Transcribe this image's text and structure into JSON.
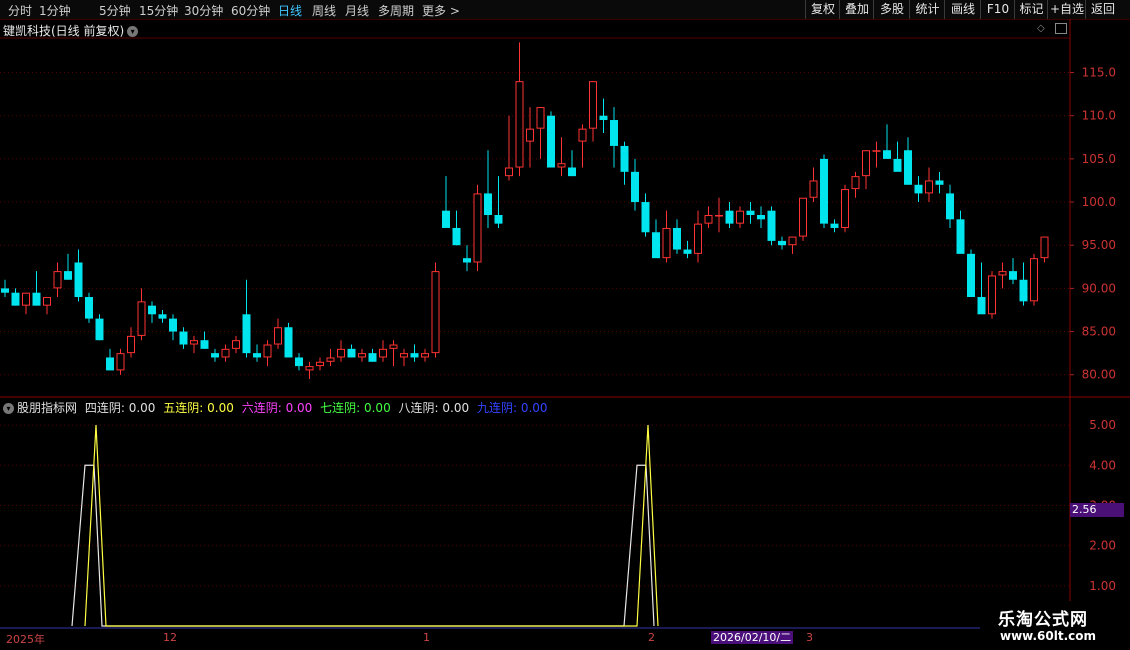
{
  "toolbar": {
    "tabs": [
      "分时",
      "1分钟",
      "5分钟",
      "15分钟",
      "30分钟",
      "60分钟",
      "日线",
      "周线",
      "月线",
      "多周期",
      "更多 >"
    ],
    "active_tab": "日线",
    "right_buttons": [
      "复权",
      "叠加",
      "多股",
      "统计",
      "画线",
      "F10",
      "标记",
      "+自选",
      "返回"
    ]
  },
  "main_title": "键凯科技(日线 前复权)",
  "indicator": {
    "name": "股朋指标网",
    "items": [
      {
        "label": "四连阴:",
        "value": "0.00",
        "color": "#e0e0e0"
      },
      {
        "label": "五连阴:",
        "value": "0.00",
        "color": "#ffff44"
      },
      {
        "label": "六连阴:",
        "value": "0.00",
        "color": "#ff44ff"
      },
      {
        "label": "七连阴:",
        "value": "0.00",
        "color": "#44ff44"
      },
      {
        "label": "八连阴:",
        "value": "0.00",
        "color": "#e0e0e0"
      },
      {
        "label": "九连阴:",
        "value": "0.00",
        "color": "#3344ff"
      }
    ]
  },
  "axis": {
    "price_ticks": [
      "115.0",
      "110.0",
      "105.0",
      "100.0",
      "95.00",
      "90.00",
      "85.00",
      "80.00"
    ],
    "indicator_ticks": [
      "5.00",
      "4.00",
      "3.00",
      "2.00",
      "1.00"
    ],
    "value_badge": "2.56",
    "x_labels": [
      "2025年",
      "12",
      "1",
      "2",
      "3"
    ],
    "date_badge": "2026/02/10/二"
  },
  "watermark": {
    "line1": "乐淘公式网",
    "line2": "www.60lt.com"
  },
  "colors": {
    "up": "#ff3333",
    "down": "#00e5ee",
    "grid": "#5a0000",
    "axis_text": "#cc3333"
  },
  "chart_data": {
    "type": "candlestick",
    "price_range": [
      78,
      119
    ],
    "candles": [
      [
        90,
        91,
        89,
        89.5
      ],
      [
        89.5,
        90,
        88,
        88
      ],
      [
        88,
        89.5,
        87,
        89.5
      ],
      [
        89.5,
        92,
        88,
        88
      ],
      [
        88,
        89,
        87,
        89
      ],
      [
        90,
        93,
        89,
        92
      ],
      [
        92,
        94,
        91,
        91
      ],
      [
        93,
        94.5,
        88.5,
        89
      ],
      [
        89,
        89.5,
        86,
        86.5
      ],
      [
        86.5,
        87,
        84,
        84
      ],
      [
        82,
        83,
        81,
        80.5
      ],
      [
        80.5,
        83,
        80,
        82.5
      ],
      [
        82.5,
        85.5,
        82,
        84.5
      ],
      [
        84.5,
        90,
        84,
        88.5
      ],
      [
        88,
        88.5,
        86,
        87
      ],
      [
        87,
        87.5,
        86,
        86.5
      ],
      [
        86.5,
        87,
        84,
        85
      ],
      [
        85,
        85.5,
        83,
        83.5
      ],
      [
        83.5,
        84.5,
        82.5,
        84
      ],
      [
        84,
        85,
        83,
        83
      ],
      [
        82.5,
        83,
        81.5,
        82
      ],
      [
        82,
        83.5,
        81.5,
        83
      ],
      [
        83,
        84.5,
        82.5,
        84
      ],
      [
        87,
        91,
        82,
        82.5
      ],
      [
        82.5,
        83.5,
        81.5,
        82
      ],
      [
        82,
        84,
        81,
        83.5
      ],
      [
        83.5,
        86.5,
        83,
        85.5
      ],
      [
        85.5,
        86,
        83,
        82
      ],
      [
        82,
        82.5,
        80.5,
        81
      ],
      [
        80.5,
        81.5,
        79.5,
        81
      ],
      [
        81,
        82,
        80.5,
        81.5
      ],
      [
        81.5,
        83,
        81,
        82
      ],
      [
        82,
        84,
        81.5,
        83
      ],
      [
        83,
        83.5,
        82,
        82
      ],
      [
        82,
        83,
        81.5,
        82.5
      ],
      [
        82.5,
        83,
        81.5,
        81.5
      ],
      [
        82,
        84,
        81.5,
        83
      ],
      [
        83,
        84,
        81,
        83.5
      ],
      [
        82,
        83,
        81,
        82.5
      ],
      [
        82.5,
        83.5,
        81.5,
        82
      ],
      [
        82,
        83,
        81.5,
        82.5
      ],
      [
        82.5,
        93,
        82,
        92
      ],
      [
        99,
        103,
        97.5,
        97
      ],
      [
        97,
        99,
        95,
        95
      ],
      [
        93.5,
        95,
        92,
        93
      ],
      [
        93,
        102,
        92,
        101
      ],
      [
        101,
        106,
        97,
        98.5
      ],
      [
        98.5,
        103,
        97,
        97.5
      ],
      [
        103,
        110,
        102.5,
        104
      ],
      [
        104,
        118.5,
        103,
        114
      ],
      [
        107,
        111,
        104,
        108.5
      ],
      [
        108.5,
        111,
        105,
        111
      ],
      [
        110,
        110.5,
        105,
        104
      ],
      [
        104,
        107.5,
        103,
        104.5
      ],
      [
        104,
        106,
        103,
        103
      ],
      [
        107,
        109,
        104,
        108.5
      ],
      [
        108.5,
        114,
        107,
        114
      ],
      [
        110,
        112,
        108,
        109.5
      ],
      [
        109.5,
        111,
        104,
        106.5
      ],
      [
        106.5,
        107,
        102,
        103.5
      ],
      [
        103.5,
        105,
        99,
        100
      ],
      [
        100,
        101,
        96,
        96.5
      ],
      [
        96.5,
        98,
        95,
        93.5
      ],
      [
        93.5,
        99,
        93,
        97
      ],
      [
        97,
        98,
        94,
        94.5
      ],
      [
        94.5,
        95.5,
        93.5,
        94
      ],
      [
        94,
        99,
        93,
        97.5
      ],
      [
        97.5,
        99.5,
        97,
        98.5
      ],
      [
        98.5,
        100.5,
        96.5,
        98.5
      ],
      [
        99,
        100,
        97,
        97.5
      ],
      [
        97.5,
        99.5,
        97,
        99
      ],
      [
        99,
        100,
        97.5,
        98.5
      ],
      [
        98.5,
        99.5,
        97,
        98
      ],
      [
        99,
        99.5,
        95,
        95.5
      ],
      [
        95.5,
        96,
        94.5,
        95
      ],
      [
        95,
        96,
        94,
        96
      ],
      [
        96,
        100,
        95.5,
        100.5
      ],
      [
        100.5,
        104,
        100,
        102.5
      ],
      [
        105,
        105.5,
        97,
        97.5
      ],
      [
        97.5,
        98,
        96.5,
        97
      ],
      [
        97,
        102,
        96.5,
        101.5
      ],
      [
        101.5,
        103.5,
        100.5,
        103
      ],
      [
        103,
        106,
        101.5,
        106
      ],
      [
        106,
        107,
        104,
        106
      ],
      [
        106,
        109,
        105,
        105
      ],
      [
        105,
        107,
        104,
        103.5
      ],
      [
        106,
        107.5,
        102,
        102
      ],
      [
        102,
        103,
        100,
        101
      ],
      [
        101,
        104,
        100,
        102.5
      ],
      [
        102.5,
        103.5,
        101,
        102
      ],
      [
        101,
        102,
        97,
        98
      ],
      [
        98,
        99,
        95,
        94
      ],
      [
        94,
        94.5,
        91,
        89
      ],
      [
        89,
        93,
        87.5,
        87
      ],
      [
        87,
        92,
        86.5,
        91.5
      ],
      [
        91.5,
        93,
        90,
        92
      ],
      [
        92,
        93.5,
        90.5,
        91
      ],
      [
        91,
        93,
        88,
        88.5
      ],
      [
        88.5,
        94,
        88,
        93.5
      ],
      [
        93.5,
        96,
        93,
        96
      ]
    ]
  },
  "indicator_data": {
    "range": [
      0,
      5.5
    ],
    "white": [
      [
        72,
        0
      ],
      [
        85,
        4
      ],
      [
        94,
        4
      ],
      [
        102,
        0
      ],
      [
        624,
        0
      ],
      [
        637,
        4
      ],
      [
        646,
        4
      ],
      [
        654,
        0
      ]
    ],
    "yellow": [
      [
        85,
        0
      ],
      [
        96,
        5
      ],
      [
        106,
        0
      ],
      [
        637,
        0
      ],
      [
        648,
        5
      ],
      [
        658,
        0
      ]
    ]
  }
}
